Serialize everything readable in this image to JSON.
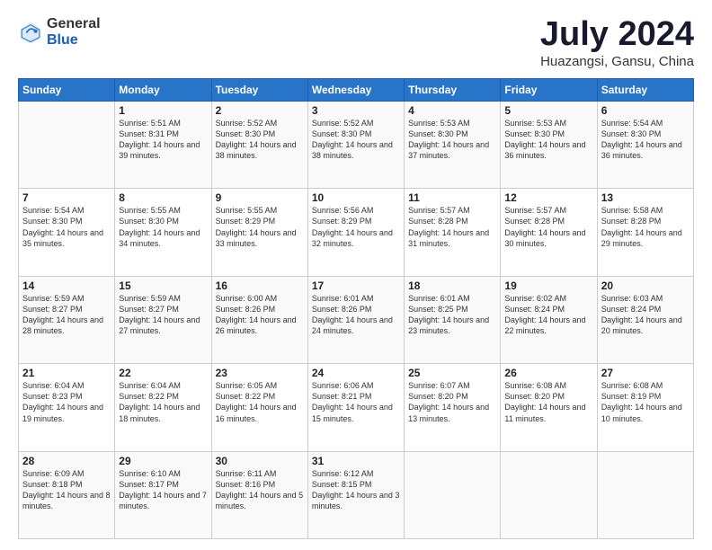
{
  "logo": {
    "general": "General",
    "blue": "Blue"
  },
  "title": "July 2024",
  "subtitle": "Huazangsi, Gansu, China",
  "headers": [
    "Sunday",
    "Monday",
    "Tuesday",
    "Wednesday",
    "Thursday",
    "Friday",
    "Saturday"
  ],
  "weeks": [
    [
      {
        "day": "",
        "sunrise": "",
        "sunset": "",
        "daylight": ""
      },
      {
        "day": "1",
        "sunrise": "Sunrise: 5:51 AM",
        "sunset": "Sunset: 8:31 PM",
        "daylight": "Daylight: 14 hours and 39 minutes."
      },
      {
        "day": "2",
        "sunrise": "Sunrise: 5:52 AM",
        "sunset": "Sunset: 8:30 PM",
        "daylight": "Daylight: 14 hours and 38 minutes."
      },
      {
        "day": "3",
        "sunrise": "Sunrise: 5:52 AM",
        "sunset": "Sunset: 8:30 PM",
        "daylight": "Daylight: 14 hours and 38 minutes."
      },
      {
        "day": "4",
        "sunrise": "Sunrise: 5:53 AM",
        "sunset": "Sunset: 8:30 PM",
        "daylight": "Daylight: 14 hours and 37 minutes."
      },
      {
        "day": "5",
        "sunrise": "Sunrise: 5:53 AM",
        "sunset": "Sunset: 8:30 PM",
        "daylight": "Daylight: 14 hours and 36 minutes."
      },
      {
        "day": "6",
        "sunrise": "Sunrise: 5:54 AM",
        "sunset": "Sunset: 8:30 PM",
        "daylight": "Daylight: 14 hours and 36 minutes."
      }
    ],
    [
      {
        "day": "7",
        "sunrise": "Sunrise: 5:54 AM",
        "sunset": "Sunset: 8:30 PM",
        "daylight": "Daylight: 14 hours and 35 minutes."
      },
      {
        "day": "8",
        "sunrise": "Sunrise: 5:55 AM",
        "sunset": "Sunset: 8:30 PM",
        "daylight": "Daylight: 14 hours and 34 minutes."
      },
      {
        "day": "9",
        "sunrise": "Sunrise: 5:55 AM",
        "sunset": "Sunset: 8:29 PM",
        "daylight": "Daylight: 14 hours and 33 minutes."
      },
      {
        "day": "10",
        "sunrise": "Sunrise: 5:56 AM",
        "sunset": "Sunset: 8:29 PM",
        "daylight": "Daylight: 14 hours and 32 minutes."
      },
      {
        "day": "11",
        "sunrise": "Sunrise: 5:57 AM",
        "sunset": "Sunset: 8:28 PM",
        "daylight": "Daylight: 14 hours and 31 minutes."
      },
      {
        "day": "12",
        "sunrise": "Sunrise: 5:57 AM",
        "sunset": "Sunset: 8:28 PM",
        "daylight": "Daylight: 14 hours and 30 minutes."
      },
      {
        "day": "13",
        "sunrise": "Sunrise: 5:58 AM",
        "sunset": "Sunset: 8:28 PM",
        "daylight": "Daylight: 14 hours and 29 minutes."
      }
    ],
    [
      {
        "day": "14",
        "sunrise": "Sunrise: 5:59 AM",
        "sunset": "Sunset: 8:27 PM",
        "daylight": "Daylight: 14 hours and 28 minutes."
      },
      {
        "day": "15",
        "sunrise": "Sunrise: 5:59 AM",
        "sunset": "Sunset: 8:27 PM",
        "daylight": "Daylight: 14 hours and 27 minutes."
      },
      {
        "day": "16",
        "sunrise": "Sunrise: 6:00 AM",
        "sunset": "Sunset: 8:26 PM",
        "daylight": "Daylight: 14 hours and 26 minutes."
      },
      {
        "day": "17",
        "sunrise": "Sunrise: 6:01 AM",
        "sunset": "Sunset: 8:26 PM",
        "daylight": "Daylight: 14 hours and 24 minutes."
      },
      {
        "day": "18",
        "sunrise": "Sunrise: 6:01 AM",
        "sunset": "Sunset: 8:25 PM",
        "daylight": "Daylight: 14 hours and 23 minutes."
      },
      {
        "day": "19",
        "sunrise": "Sunrise: 6:02 AM",
        "sunset": "Sunset: 8:24 PM",
        "daylight": "Daylight: 14 hours and 22 minutes."
      },
      {
        "day": "20",
        "sunrise": "Sunrise: 6:03 AM",
        "sunset": "Sunset: 8:24 PM",
        "daylight": "Daylight: 14 hours and 20 minutes."
      }
    ],
    [
      {
        "day": "21",
        "sunrise": "Sunrise: 6:04 AM",
        "sunset": "Sunset: 8:23 PM",
        "daylight": "Daylight: 14 hours and 19 minutes."
      },
      {
        "day": "22",
        "sunrise": "Sunrise: 6:04 AM",
        "sunset": "Sunset: 8:22 PM",
        "daylight": "Daylight: 14 hours and 18 minutes."
      },
      {
        "day": "23",
        "sunrise": "Sunrise: 6:05 AM",
        "sunset": "Sunset: 8:22 PM",
        "daylight": "Daylight: 14 hours and 16 minutes."
      },
      {
        "day": "24",
        "sunrise": "Sunrise: 6:06 AM",
        "sunset": "Sunset: 8:21 PM",
        "daylight": "Daylight: 14 hours and 15 minutes."
      },
      {
        "day": "25",
        "sunrise": "Sunrise: 6:07 AM",
        "sunset": "Sunset: 8:20 PM",
        "daylight": "Daylight: 14 hours and 13 minutes."
      },
      {
        "day": "26",
        "sunrise": "Sunrise: 6:08 AM",
        "sunset": "Sunset: 8:20 PM",
        "daylight": "Daylight: 14 hours and 11 minutes."
      },
      {
        "day": "27",
        "sunrise": "Sunrise: 6:08 AM",
        "sunset": "Sunset: 8:19 PM",
        "daylight": "Daylight: 14 hours and 10 minutes."
      }
    ],
    [
      {
        "day": "28",
        "sunrise": "Sunrise: 6:09 AM",
        "sunset": "Sunset: 8:18 PM",
        "daylight": "Daylight: 14 hours and 8 minutes."
      },
      {
        "day": "29",
        "sunrise": "Sunrise: 6:10 AM",
        "sunset": "Sunset: 8:17 PM",
        "daylight": "Daylight: 14 hours and 7 minutes."
      },
      {
        "day": "30",
        "sunrise": "Sunrise: 6:11 AM",
        "sunset": "Sunset: 8:16 PM",
        "daylight": "Daylight: 14 hours and 5 minutes."
      },
      {
        "day": "31",
        "sunrise": "Sunrise: 6:12 AM",
        "sunset": "Sunset: 8:15 PM",
        "daylight": "Daylight: 14 hours and 3 minutes."
      },
      {
        "day": "",
        "sunrise": "",
        "sunset": "",
        "daylight": ""
      },
      {
        "day": "",
        "sunrise": "",
        "sunset": "",
        "daylight": ""
      },
      {
        "day": "",
        "sunrise": "",
        "sunset": "",
        "daylight": ""
      }
    ]
  ]
}
